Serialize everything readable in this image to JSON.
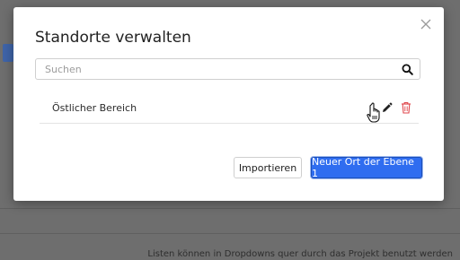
{
  "dialog": {
    "title": "Standorte verwalten",
    "search_placeholder": "Suchen",
    "items": [
      {
        "label": "Östlicher Bereich"
      }
    ],
    "import_label": "Importieren",
    "new_label": "Neuer Ort der Ebene 1"
  },
  "background": {
    "footnote": "Listen können in Dropdowns quer durch das Projekt benutzt werden"
  },
  "colors": {
    "primary": "#2f6df0",
    "delete": "#e0474c",
    "overlay": "#6e6e6e"
  },
  "icons": [
    "close-icon",
    "search-icon",
    "pencil-icon",
    "trash-icon",
    "hand-cursor-icon"
  ]
}
